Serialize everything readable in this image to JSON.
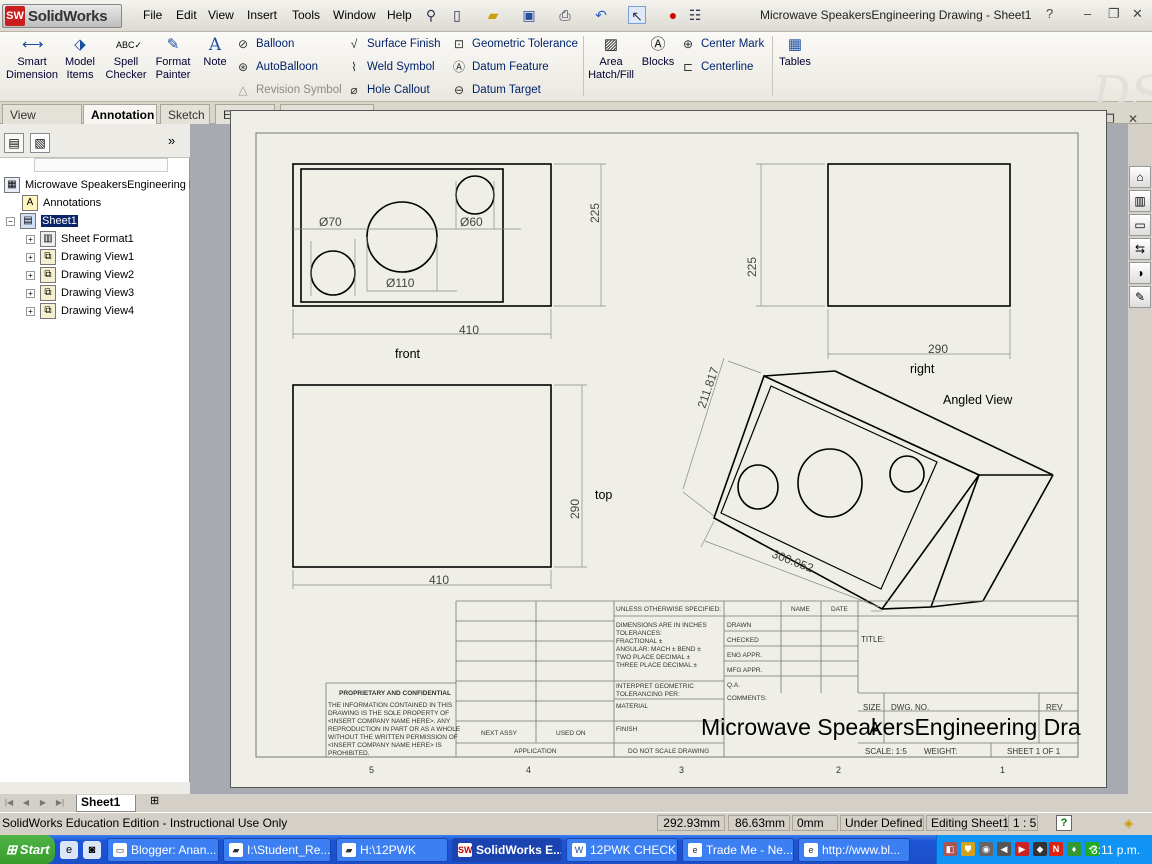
{
  "app": {
    "brand": "SolidWorks",
    "brand_badge": "SW",
    "document_title": "Microwave SpeakersEngineering Drawing - Sheet1",
    "menu": [
      "File",
      "Edit",
      "View",
      "Insert",
      "Tools",
      "Window",
      "Help"
    ]
  },
  "ribbon": {
    "smart_dimension": "Smart Dimension",
    "model_items": "Model Items",
    "spell_checker": "Spell Checker",
    "format_painter": "Format Painter",
    "note": "Note",
    "balloon": "Balloon",
    "autoballoon": "AutoBalloon",
    "revision_symbol": "Revision Symbol",
    "surface_finish": "Surface Finish",
    "weld_symbol": "Weld Symbol",
    "hole_callout": "Hole Callout",
    "geometric_tolerance": "Geometric Tolerance",
    "datum_feature": "Datum Feature",
    "datum_target": "Datum Target",
    "area_hatch_fill": "Area Hatch/Fill",
    "blocks": "Blocks",
    "center_mark": "Center Mark",
    "centerline": "Centerline",
    "tables": "Tables"
  },
  "tabs": [
    {
      "label": "View Layout",
      "active": false
    },
    {
      "label": "Annotation",
      "active": true
    },
    {
      "label": "Sketch",
      "active": false
    },
    {
      "label": "Evaluate",
      "active": false
    },
    {
      "label": "Office Products",
      "active": false
    }
  ],
  "feature_tree": {
    "root": "Microwave SpeakersEngineering D",
    "annotations": "Annotations",
    "sheet": "Sheet1",
    "children": [
      "Sheet Format1",
      "Drawing View1",
      "Drawing View2",
      "Drawing View3",
      "Drawing View4"
    ]
  },
  "drawing": {
    "front_label": "front",
    "right_label": "right",
    "top_label": "top",
    "angled_label": "Angled View",
    "dims": {
      "front_width": "410",
      "front_height": "225",
      "dia_70": "Ø70",
      "dia_60": "Ø60",
      "dia_110": "Ø110",
      "right_height": "225",
      "right_width": "290",
      "top_depth": "290",
      "top_width": "410",
      "angled_height": "211.817",
      "angled_width": "300.052"
    },
    "title_block": {
      "unless_specified": "UNLESS OTHERWISE SPECIFIED:",
      "name": "NAME",
      "date": "DATE",
      "dimensions_note": "DIMENSIONS ARE IN INCHES",
      "tolerances": "TOLERANCES:",
      "fractional": "FRACTIONAL ±",
      "angular": "ANGULAR: MACH ±   BEND ±",
      "two_place": "TWO PLACE DECIMAL   ±",
      "three_place": "THREE PLACE DECIMAL  ±",
      "interpret": "INTERPRET GEOMETRIC",
      "tolerancing": "TOLERANCING PER:",
      "material": "MATERIAL",
      "finish": "FINISH",
      "drawn": "DRAWN",
      "checked": "CHECKED",
      "eng_appr": "ENG APPR.",
      "mfg_appr": "MFG APPR.",
      "qa": "Q.A.",
      "comments": "COMMENTS:",
      "title": "TITLE:",
      "size": "SIZE",
      "dwg_no": "DWG.  NO.",
      "rev": "REV",
      "drawing_name": "Microwave SpeakersEngineering Dra",
      "size_value": "A",
      "scale": "SCALE: 1:5",
      "weight": "WEIGHT:",
      "sheet_of": "SHEET 1 OF 1",
      "proprietary": "PROPRIETARY AND CONFIDENTIAL",
      "proprietary_text": [
        "THE INFORMATION CONTAINED IN THIS",
        "DRAWING IS THE SOLE PROPERTY OF",
        "<INSERT COMPANY NAME HERE>.  ANY",
        "REPRODUCTION IN PART OR AS A WHOLE",
        "WITHOUT THE WRITTEN PERMISSION OF",
        "<INSERT COMPANY NAME HERE> IS",
        "PROHIBITED."
      ],
      "next_assy": "NEXT ASSY",
      "used_on": "USED ON",
      "application": "APPLICATION",
      "do_not_scale": "DO NOT SCALE DRAWING",
      "zones": [
        "5",
        "4",
        "3",
        "2",
        "1"
      ]
    }
  },
  "sheet_tab": "Sheet1",
  "status": {
    "edition": "SolidWorks Education Edition - Instructional Use Only",
    "x": "292.93mm",
    "y": "86.63mm",
    "z": "0mm",
    "state": "Under Defined",
    "editing": "Editing Sheet1",
    "scale": "1 : 5"
  },
  "taskbar": {
    "start": "Start",
    "tasks": [
      {
        "label": "Blogger: Anan...",
        "active": false
      },
      {
        "label": "I:\\Student_Re...",
        "active": false
      },
      {
        "label": "H:\\12PWK",
        "active": false
      },
      {
        "label": "SolidWorks E...",
        "active": true
      },
      {
        "label": "12PWK CHECK...",
        "active": false
      },
      {
        "label": "Trade Me - Ne...",
        "active": false
      },
      {
        "label": "http://www.bl...",
        "active": false
      }
    ],
    "clock": "3:11 p.m."
  }
}
